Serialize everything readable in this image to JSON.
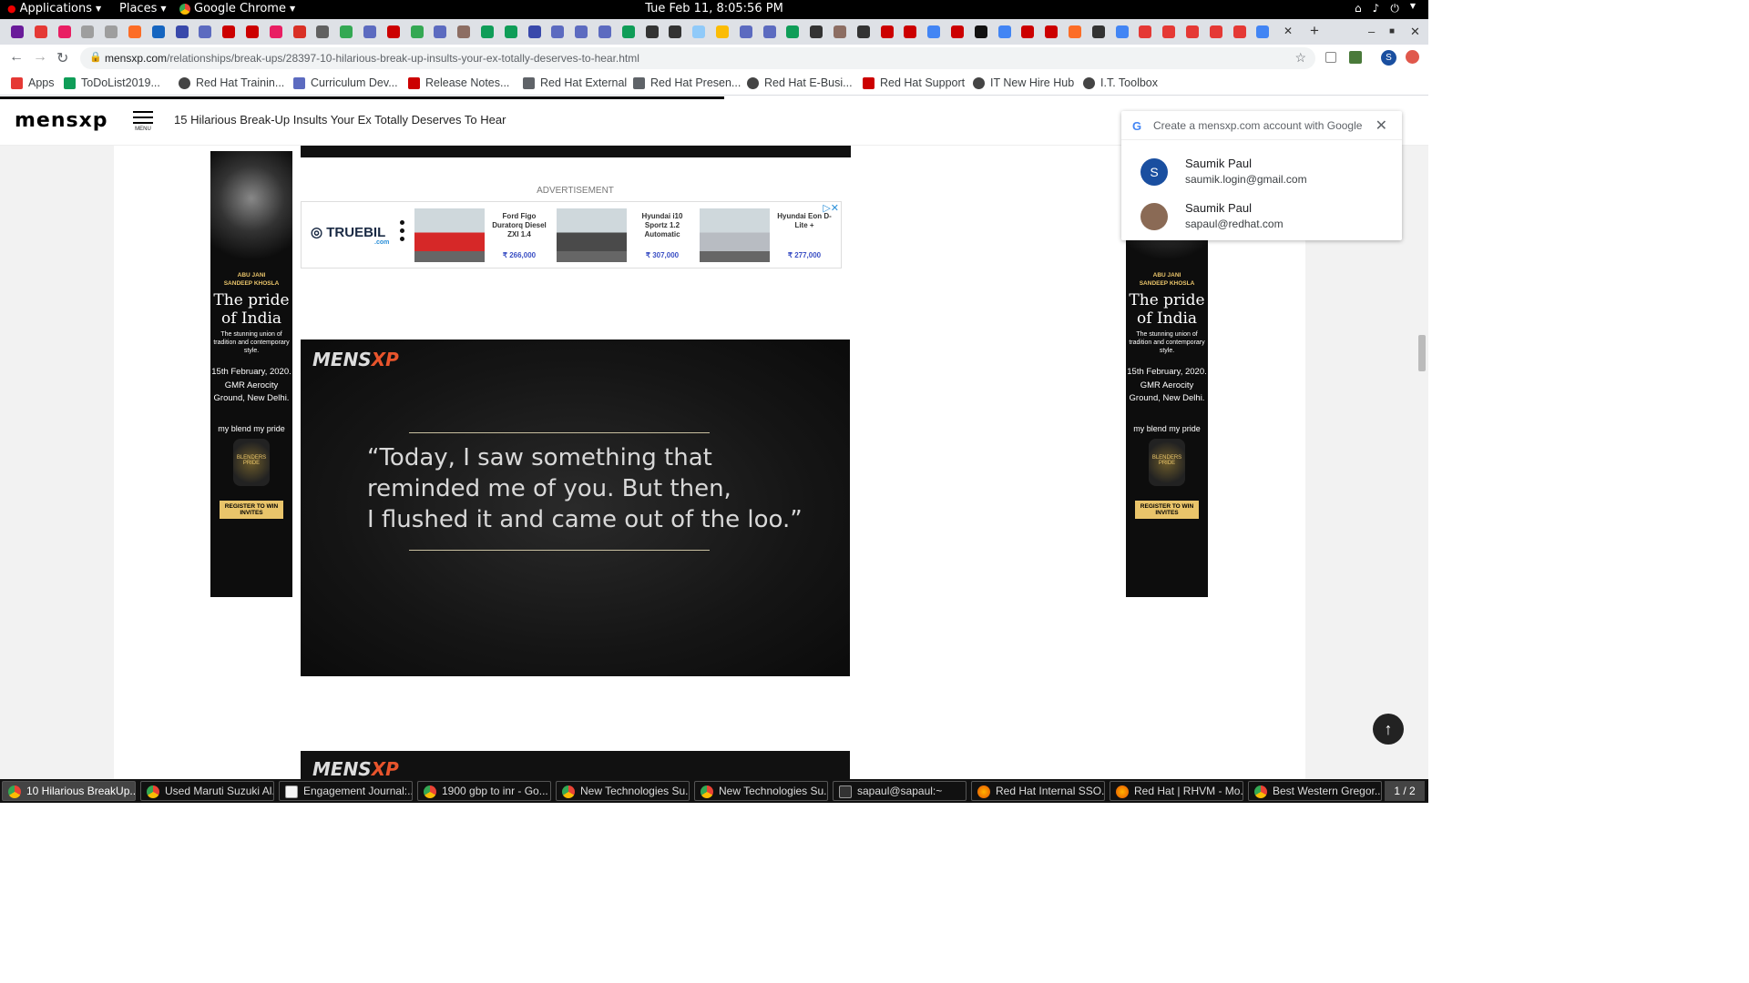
{
  "system_bar": {
    "applications": "Applications",
    "places": "Places",
    "app": "Google Chrome",
    "clock": "Tue Feb 11,  8:05:56 PM"
  },
  "browser": {
    "url_domain": "mensxp.com",
    "url_path": "/relationships/break-ups/28397-10-hilarious-break-up-insults-your-ex-totally-deserves-to-hear.html",
    "bookmarks": [
      {
        "label": "Apps",
        "icon": "apps-grid-icon",
        "color": "#e53935"
      },
      {
        "label": "ToDoList2019...",
        "icon": "sheets-icon",
        "color": "#0f9d58"
      },
      {
        "label": "Red Hat Trainin...",
        "icon": "globe-icon",
        "color": "#444444"
      },
      {
        "label": "Curriculum Dev...",
        "icon": "docs-icon",
        "color": "#5c6bc0"
      },
      {
        "label": "Release Notes...",
        "icon": "redhat-icon",
        "color": "#cc0000"
      },
      {
        "label": "Red Hat External",
        "icon": "folder-icon",
        "color": "#5f6368"
      },
      {
        "label": "Red Hat Presen...",
        "icon": "folder-icon",
        "color": "#5f6368"
      },
      {
        "label": "Red Hat E-Busi...",
        "icon": "globe-icon",
        "color": "#444444"
      },
      {
        "label": "Red Hat Support",
        "icon": "redhat-news-icon",
        "color": "#cc0000"
      },
      {
        "label": "IT New Hire Hub",
        "icon": "globe-icon",
        "color": "#444444"
      },
      {
        "label": "I.T. Toolbox",
        "icon": "globe-icon",
        "color": "#444444"
      }
    ]
  },
  "site": {
    "logo": "mensxp",
    "menu_label": "MENU",
    "headline": "15 Hilarious Break-Up Insults Your Ex Totally Deserves To Hear"
  },
  "side_ad": {
    "brand_line1": "ABU JANI",
    "brand_line2": "SANDEEP KHOSLA",
    "title": "The pride of India",
    "subtitle": "The stunning union of tradition and contemporary style.",
    "date": "15th February, 2020.",
    "venue": "GMR Aerocity Ground, New Delhi.",
    "tagline": "my blend my pride",
    "bottle": "BLENDERS PRIDE",
    "cta": "REGISTER TO WIN INVITES"
  },
  "advert": {
    "label": "ADVERTISEMENT",
    "brand": "TRUEBIL",
    "brand_sub": ".com",
    "cars": [
      {
        "name": "Ford Figo Duratorq Diesel ZXI 1.4",
        "price": "₹ 266,000",
        "color": "#d62828"
      },
      {
        "name": "Hyundai i10 Sportz 1.2 Automatic",
        "price": "₹ 307,000",
        "color": "#4a4a4a"
      },
      {
        "name": "Hyundai Eon D-Lite +",
        "price": "₹ 277,000",
        "color": "#b8bcc2"
      }
    ]
  },
  "quote_card": {
    "logo_main": "MENS",
    "logo_accent": "XP",
    "line1": "“Today, I saw something that",
    "line2": "reminded me of you. But then,",
    "line3": "I flushed it and came out of the loo.”"
  },
  "google_popup": {
    "header": "Create a mensxp.com account with Google",
    "accounts": [
      {
        "initial": "S",
        "name": "Saumik Paul",
        "email": "saumik.login@gmail.com",
        "avatar_color": "#1a4fa0"
      },
      {
        "initial": "",
        "name": "Saumik Paul",
        "email": "sapaul@redhat.com",
        "avatar_color": "#8a6a55"
      }
    ]
  },
  "taskbar": {
    "items": [
      {
        "label": "10 Hilarious BreakUp...",
        "icon": "chrome-icon",
        "active": true
      },
      {
        "label": "Used Maruti Suzuki Al...",
        "icon": "chrome-icon",
        "active": false
      },
      {
        "label": "Engagement Journal:...",
        "icon": "journal-icon",
        "active": false
      },
      {
        "label": "1900 gbp to inr - Go...",
        "icon": "chrome-icon",
        "active": false
      },
      {
        "label": "New Technologies Su...",
        "icon": "chrome-icon",
        "active": false
      },
      {
        "label": "New Technologies Su...",
        "icon": "chrome-icon",
        "active": false
      },
      {
        "label": "sapaul@sapaul:~",
        "icon": "terminal-icon",
        "active": false
      },
      {
        "label": "Red Hat Internal SSO...",
        "icon": "firefox-icon",
        "active": false
      },
      {
        "label": "Red Hat | RHVM - Mo...",
        "icon": "firefox-icon",
        "active": false
      },
      {
        "label": "Best Western Gregor...",
        "icon": "chrome-icon",
        "active": false
      }
    ],
    "workspace": "1 / 2"
  }
}
